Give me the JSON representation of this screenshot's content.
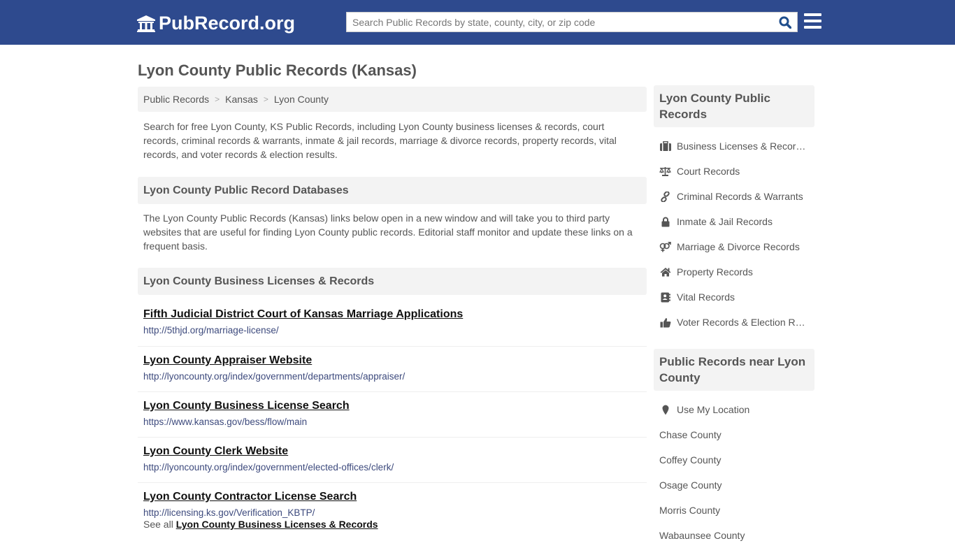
{
  "header": {
    "logo_text": "PubRecord.org",
    "search_placeholder": "Search Public Records by state, county, city, or zip code",
    "search_value": "",
    "colors": {
      "bar": "#2e4a8e",
      "search_icon": "#1f4e8c"
    }
  },
  "page": {
    "title": "Lyon County Public Records (Kansas)",
    "breadcrumb": [
      "Public Records",
      "Kansas",
      "Lyon County"
    ],
    "intro": "Search for free Lyon County, KS Public Records, including Lyon County business licenses & records, court records, criminal records & warrants, inmate & jail records, marriage & divorce records, property records, vital records, and voter records & election results."
  },
  "databases": {
    "heading": "Lyon County Public Record Databases",
    "description": "The Lyon County Public Records (Kansas) links below open in a new window and will take you to third party websites that are useful for finding Lyon County public records. Editorial staff monitor and update these links on a frequent basis."
  },
  "business": {
    "heading": "Lyon County Business Licenses & Records",
    "links": [
      {
        "title": "Fifth Judicial District Court of Kansas Marriage Applications",
        "url": "http://5thjd.org/marriage-license/"
      },
      {
        "title": "Lyon County Appraiser Website",
        "url": "http://lyoncounty.org/index/government/departments/appraiser/"
      },
      {
        "title": "Lyon County Business License Search",
        "url": "https://www.kansas.gov/bess/flow/main"
      },
      {
        "title": "Lyon County Clerk Website",
        "url": "http://lyoncounty.org/index/government/elected-offices/clerk/"
      },
      {
        "title": "Lyon County Contractor License Search",
        "url": "http://licensing.ks.gov/Verification_KBTP/"
      }
    ],
    "see_all_prefix": "See all",
    "see_all_link": "Lyon County Business Licenses & Records"
  },
  "sidebar": {
    "records_heading": "Lyon County Public Records",
    "records": [
      {
        "icon": "briefcase-icon",
        "label": "Business Licenses & Records"
      },
      {
        "icon": "balance-scale-icon",
        "label": "Court Records"
      },
      {
        "icon": "link-icon",
        "label": "Criminal Records & Warrants"
      },
      {
        "icon": "lock-icon",
        "label": "Inmate & Jail Records"
      },
      {
        "icon": "venus-mars-icon",
        "label": "Marriage & Divorce Records"
      },
      {
        "icon": "home-icon",
        "label": "Property Records"
      },
      {
        "icon": "address-book-icon",
        "label": "Vital Records"
      },
      {
        "icon": "thumbs-up-icon",
        "label": "Voter Records & Election Results"
      }
    ],
    "near_heading": "Public Records near Lyon County",
    "use_location": "Use My Location",
    "near": [
      "Chase County",
      "Coffey County",
      "Osage County",
      "Morris County",
      "Wabaunsee County"
    ]
  }
}
